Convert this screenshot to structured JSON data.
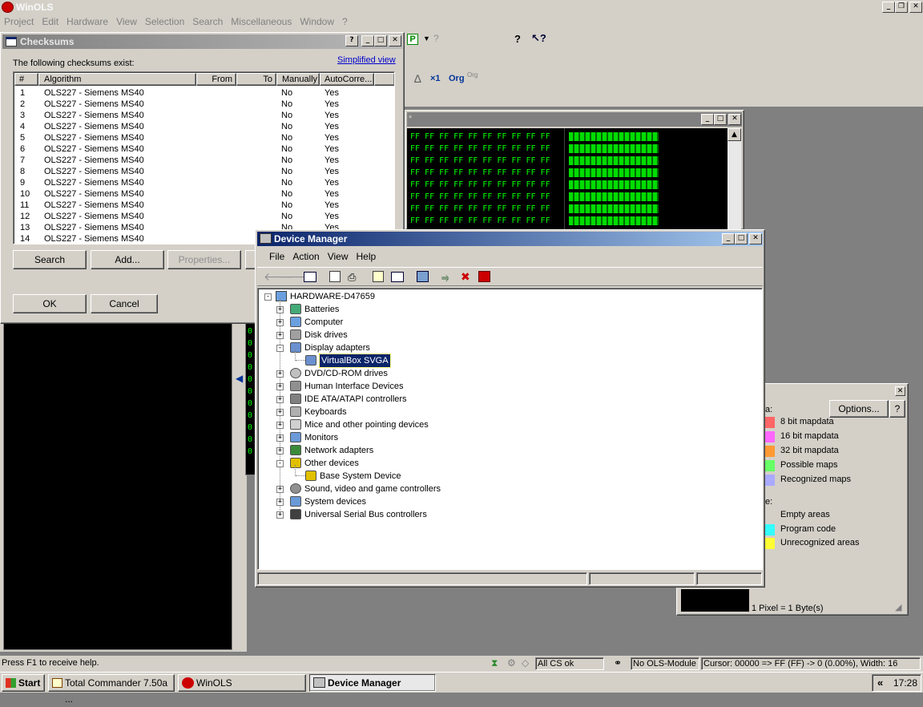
{
  "app": {
    "title": "WinOLS",
    "menu": [
      "Project",
      "Edit",
      "Hardware",
      "View",
      "Selection",
      "Search",
      "Miscellaneous",
      "Window",
      "?"
    ]
  },
  "toolbar": {
    "org1": "Org",
    "org2": "Org",
    "delta": "∆",
    "x1": "×1"
  },
  "hex_window": {
    "title": "*",
    "hex_line": "FF FF FF FF FF FF FF FF FF FF",
    "rows": 8,
    "side_digits": [
      "0",
      "0",
      "0",
      "0",
      "0",
      "0",
      "0",
      "0",
      "0",
      "0",
      "0"
    ]
  },
  "checksums": {
    "title": "Checksums",
    "intro": "The following checksums exist:",
    "simplified_link": "Simplified view",
    "columns": [
      "#",
      "Algorithm",
      "From",
      "To",
      "Manually",
      "AutoCorre..."
    ],
    "rows": [
      {
        "n": "1",
        "alg": "OLS227 - Siemens MS40",
        "man": "No",
        "auto": "Yes"
      },
      {
        "n": "2",
        "alg": "OLS227 - Siemens MS40",
        "man": "No",
        "auto": "Yes"
      },
      {
        "n": "3",
        "alg": "OLS227 - Siemens MS40",
        "man": "No",
        "auto": "Yes"
      },
      {
        "n": "4",
        "alg": "OLS227 - Siemens MS40",
        "man": "No",
        "auto": "Yes"
      },
      {
        "n": "5",
        "alg": "OLS227 - Siemens MS40",
        "man": "No",
        "auto": "Yes"
      },
      {
        "n": "6",
        "alg": "OLS227 - Siemens MS40",
        "man": "No",
        "auto": "Yes"
      },
      {
        "n": "7",
        "alg": "OLS227 - Siemens MS40",
        "man": "No",
        "auto": "Yes"
      },
      {
        "n": "8",
        "alg": "OLS227 - Siemens MS40",
        "man": "No",
        "auto": "Yes"
      },
      {
        "n": "9",
        "alg": "OLS227 - Siemens MS40",
        "man": "No",
        "auto": "Yes"
      },
      {
        "n": "10",
        "alg": "OLS227 - Siemens MS40",
        "man": "No",
        "auto": "Yes"
      },
      {
        "n": "11",
        "alg": "OLS227 - Siemens MS40",
        "man": "No",
        "auto": "Yes"
      },
      {
        "n": "12",
        "alg": "OLS227 - Siemens MS40",
        "man": "No",
        "auto": "Yes"
      },
      {
        "n": "13",
        "alg": "OLS227 - Siemens MS40",
        "man": "No",
        "auto": "Yes"
      },
      {
        "n": "14",
        "alg": "OLS227 - Siemens MS40",
        "man": "",
        "auto": ""
      }
    ],
    "search_btn": "Search",
    "add_btn": "Add...",
    "properties_btn": "Properties...",
    "ok_btn": "OK",
    "cancel_btn": "Cancel",
    "help_glyph": "?"
  },
  "legend": {
    "options_btn": "Options...",
    "help_glyph": "?",
    "section1_label": "a:",
    "section2_label": "e:",
    "items1": [
      {
        "label": "8 bit mapdata",
        "color": "#ff6666"
      },
      {
        "label": "16 bit mapdata",
        "color": "#ff66ff"
      },
      {
        "label": "32 bit mapdata",
        "color": "#ff9933"
      },
      {
        "label": "Possible maps",
        "color": "#66ff66"
      },
      {
        "label": "Recognized maps",
        "color": "#aaaaff"
      }
    ],
    "items2": [
      {
        "label": "Empty areas",
        "color": "#d4d0c8"
      },
      {
        "label": "Program code",
        "color": "#33ffff"
      },
      {
        "label": "Unrecognized areas",
        "color": "#ffff33"
      }
    ],
    "pixel_note": "1 Pixel = 1 Byte(s)"
  },
  "devmgr": {
    "title": "Device Manager",
    "menu": [
      "File",
      "Action",
      "View",
      "Help"
    ],
    "root": "HARDWARE-D47659",
    "nodes": [
      {
        "label": "Batteries",
        "level": 1,
        "exp": "+",
        "icon": "battery-icon"
      },
      {
        "label": "Computer",
        "level": 1,
        "exp": "+",
        "icon": "computer-icon"
      },
      {
        "label": "Disk drives",
        "level": 1,
        "exp": "+",
        "icon": "disk-drive-icon"
      },
      {
        "label": "Display adapters",
        "level": 1,
        "exp": "-",
        "icon": "display-adapter-icon"
      },
      {
        "label": "VirtualBox SVGA",
        "level": 2,
        "exp": "",
        "icon": "display-adapter-icon",
        "selected": true
      },
      {
        "label": "DVD/CD-ROM drives",
        "level": 1,
        "exp": "+",
        "icon": "cdrom-icon"
      },
      {
        "label": "Human Interface Devices",
        "level": 1,
        "exp": "+",
        "icon": "hid-icon"
      },
      {
        "label": "IDE ATA/ATAPI controllers",
        "level": 1,
        "exp": "+",
        "icon": "ide-controller-icon"
      },
      {
        "label": "Keyboards",
        "level": 1,
        "exp": "+",
        "icon": "keyboard-icon"
      },
      {
        "label": "Mice and other pointing devices",
        "level": 1,
        "exp": "+",
        "icon": "mouse-icon"
      },
      {
        "label": "Monitors",
        "level": 1,
        "exp": "+",
        "icon": "monitor-icon"
      },
      {
        "label": "Network adapters",
        "level": 1,
        "exp": "+",
        "icon": "network-adapter-icon"
      },
      {
        "label": "Other devices",
        "level": 1,
        "exp": "-",
        "icon": "unknown-device-icon"
      },
      {
        "label": "Base System Device",
        "level": 2,
        "exp": "",
        "icon": "unknown-device-icon"
      },
      {
        "label": "Sound, video and game controllers",
        "level": 1,
        "exp": "+",
        "icon": "sound-icon"
      },
      {
        "label": "System devices",
        "level": 1,
        "exp": "+",
        "icon": "system-device-icon"
      },
      {
        "label": "Universal Serial Bus controllers",
        "level": 1,
        "exp": "+",
        "icon": "usb-icon"
      }
    ]
  },
  "statusbar": {
    "help": "Press F1 to receive help.",
    "cs": "All CS ok",
    "module": "No OLS-Module",
    "cursor": "Cursor: 00000 => FF (FF) -> 0 (0.00%), Width: 16"
  },
  "taskbar": {
    "start": "Start",
    "tasks": [
      "Total Commander 7.50a ...",
      "WinOLS",
      "Device Manager"
    ],
    "time": "17:28",
    "chevron": "«"
  }
}
